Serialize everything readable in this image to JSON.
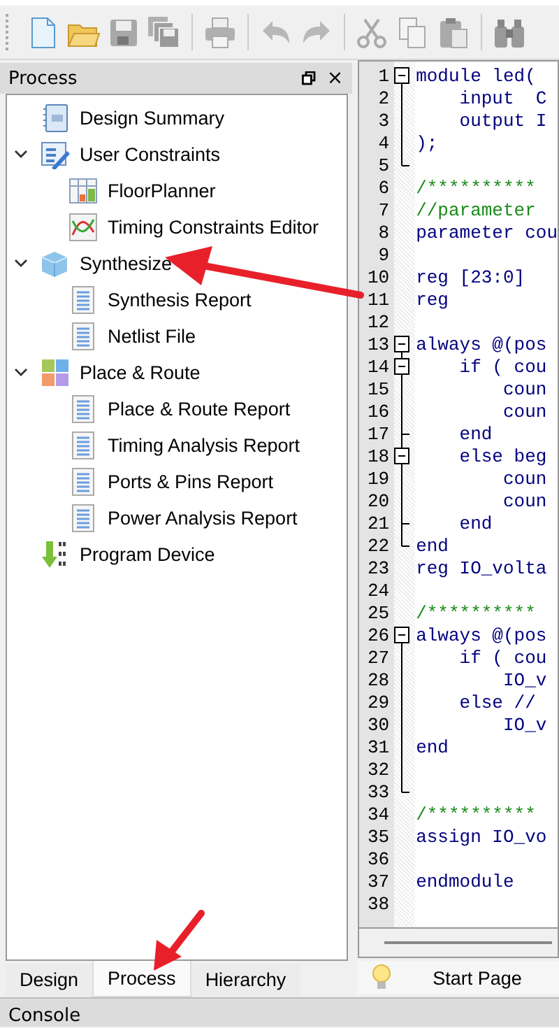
{
  "toolbar": [
    {
      "kind": "new"
    },
    {
      "kind": "open"
    },
    {
      "kind": "save"
    },
    {
      "kind": "saveall"
    },
    {
      "kind": "sep"
    },
    {
      "kind": "print"
    },
    {
      "kind": "sep"
    },
    {
      "kind": "undo"
    },
    {
      "kind": "redo"
    },
    {
      "kind": "sep"
    },
    {
      "kind": "cut"
    },
    {
      "kind": "copy"
    },
    {
      "kind": "paste"
    },
    {
      "kind": "sep"
    },
    {
      "kind": "find"
    }
  ],
  "panel": {
    "title": "Process",
    "close": "×",
    "tree": [
      {
        "label": "Design Summary",
        "kind": "summary"
      },
      {
        "label": "User Constraints",
        "kind": "constraints",
        "expanded": true,
        "children": [
          {
            "label": "FloorPlanner",
            "kind": "floor"
          },
          {
            "label": "Timing Constraints Editor",
            "kind": "timing"
          }
        ]
      },
      {
        "label": "Synthesize",
        "kind": "cube",
        "expanded": true,
        "children": [
          {
            "label": "Synthesis Report",
            "kind": "report"
          },
          {
            "label": "Netlist File",
            "kind": "report"
          }
        ]
      },
      {
        "label": "Place & Route",
        "kind": "tiles",
        "expanded": true,
        "children": [
          {
            "label": "Place & Route Report",
            "kind": "report"
          },
          {
            "label": "Timing Analysis Report",
            "kind": "report"
          },
          {
            "label": "Ports & Pins Report",
            "kind": "report"
          },
          {
            "label": "Power Analysis Report",
            "kind": "report"
          }
        ]
      },
      {
        "label": "Program Device",
        "kind": "program"
      }
    ],
    "tabs": [
      {
        "label": "Design",
        "selected": false
      },
      {
        "label": "Process",
        "selected": true
      },
      {
        "label": "Hierarchy",
        "selected": false
      }
    ]
  },
  "editor": {
    "lines": [
      {
        "num": "1",
        "text": "module led(",
        "kind": "code",
        "expanded": true,
        "children": [
          {
            "num": "2",
            "text": "    input  C",
            "kind": "code"
          },
          {
            "num": "3",
            "text": "    output I",
            "kind": "code"
          },
          {
            "num": "4",
            "text": ");",
            "kind": "code"
          },
          {
            "num": "5",
            "kind": "code"
          }
        ]
      },
      {
        "num": "6",
        "text": "/**********",
        "kind": "comment"
      },
      {
        "num": "7",
        "text": "//parameter",
        "kind": "comment"
      },
      {
        "num": "8",
        "text": "parameter cou",
        "kind": "code"
      },
      {
        "num": "9",
        "kind": "code"
      },
      {
        "num": "10",
        "text": "reg [23:0]",
        "kind": "code"
      },
      {
        "num": "11",
        "text": "reg",
        "kind": "code"
      },
      {
        "num": "12",
        "kind": "code"
      },
      {
        "num": "13",
        "text": "always @(pos",
        "kind": "code",
        "expanded": true,
        "children": [
          {
            "num": "14",
            "text": "    if ( cou",
            "kind": "code",
            "expanded": true,
            "children": [
              {
                "num": "15",
                "text": "        coun",
                "kind": "code"
              },
              {
                "num": "16",
                "text": "        coun",
                "kind": "code"
              },
              {
                "num": "17",
                "text": "    end",
                "kind": "code"
              }
            ]
          },
          {
            "num": "18",
            "text": "    else beg",
            "kind": "code",
            "expanded": true,
            "children": [
              {
                "num": "19",
                "text": "        coun",
                "kind": "code"
              },
              {
                "num": "20",
                "text": "        coun",
                "kind": "code"
              },
              {
                "num": "21",
                "text": "    end",
                "kind": "code"
              }
            ]
          },
          {
            "num": "22",
            "text": "end",
            "kind": "code"
          }
        ]
      },
      {
        "num": "23",
        "text": "reg IO_volta",
        "kind": "code"
      },
      {
        "num": "24",
        "kind": "code"
      },
      {
        "num": "25",
        "text": "/**********",
        "kind": "comment"
      },
      {
        "num": "26",
        "text": "always @(pos",
        "kind": "code",
        "expanded": true,
        "children": [
          {
            "num": "27",
            "text": "    if ( cou",
            "kind": "code"
          },
          {
            "num": "28",
            "text": "        IO_v",
            "kind": "code"
          },
          {
            "num": "29",
            "text": "    else //",
            "kind": "code"
          },
          {
            "num": "30",
            "text": "        IO_v",
            "kind": "code"
          },
          {
            "num": "31",
            "text": "end",
            "kind": "code"
          },
          {
            "num": "32",
            "kind": "code"
          },
          {
            "num": "33",
            "kind": "code"
          }
        ]
      },
      {
        "num": "34",
        "text": "/**********",
        "kind": "comment"
      },
      {
        "num": "35",
        "text": "assign IO_vo",
        "kind": "code"
      },
      {
        "num": "36",
        "kind": "code"
      },
      {
        "num": "37",
        "text": "endmodule",
        "kind": "code"
      },
      {
        "num": "38",
        "kind": "code"
      }
    ],
    "tab": "Start Page"
  },
  "console": {
    "title": "Console"
  }
}
